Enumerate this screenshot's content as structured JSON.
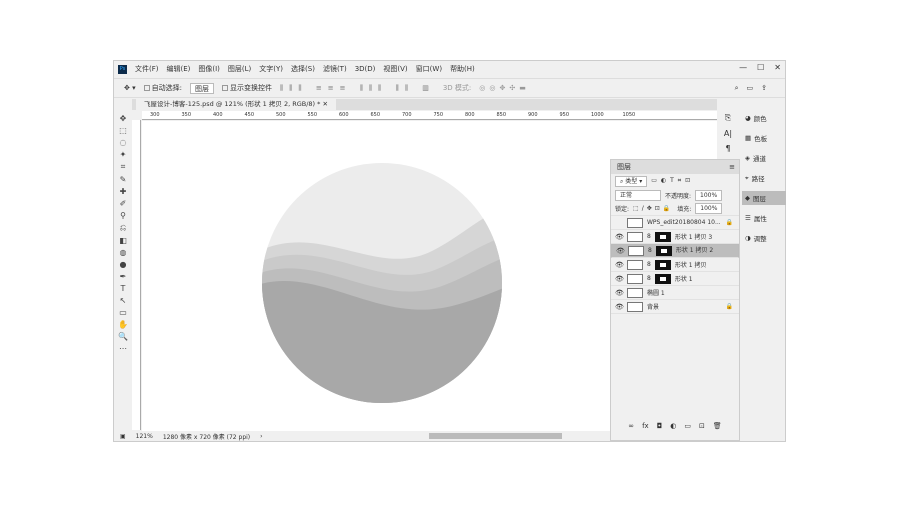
{
  "app": {
    "logo": "Ps"
  },
  "menu": [
    "文件(F)",
    "编辑(E)",
    "图像(I)",
    "图层(L)",
    "文字(Y)",
    "选择(S)",
    "滤镜(T)",
    "3D(D)",
    "视图(V)",
    "窗口(W)",
    "帮助(H)"
  ],
  "window_controls": [
    "—",
    "☐",
    "✕"
  ],
  "options": {
    "auto_select": "自动选择:",
    "target": "图层",
    "show_transform": "显示变换控件",
    "mode_3d": "3D 模式:"
  },
  "document_tab": "飞屋设计-博客-125.psd @ 121% (形状 1 拷贝 2, RGB/8) *",
  "ruler_labels": [
    "300",
    "350",
    "400",
    "450",
    "500",
    "550",
    "600",
    "650",
    "700",
    "750",
    "800",
    "850",
    "900",
    "950",
    "1000",
    "1050"
  ],
  "status": {
    "zoom": "121%",
    "doc_size": "1280 像素 x 720 像素 (72 ppi)"
  },
  "layers_panel": {
    "title": "图层",
    "filter": "类型",
    "blend_mode": "正常",
    "opacity_label": "不透明度:",
    "opacity": "100%",
    "lock_label": "锁定:",
    "fill_label": "填充:",
    "fill": "100%",
    "layers": [
      {
        "name": "WPS_edit20180804 10...",
        "visible": false,
        "mask": false,
        "locked": true,
        "selected": false
      },
      {
        "name": "形状 1 拷贝 3",
        "visible": true,
        "mask": true,
        "selected": false
      },
      {
        "name": "形状 1 拷贝 2",
        "visible": true,
        "mask": true,
        "selected": true
      },
      {
        "name": "形状 1 拷贝",
        "visible": true,
        "mask": true,
        "selected": false
      },
      {
        "name": "形状 1",
        "visible": true,
        "mask": true,
        "selected": false
      },
      {
        "name": "椭圆 1",
        "visible": true,
        "mask": false,
        "selected": false
      },
      {
        "name": "背景",
        "visible": true,
        "mask": false,
        "locked": true,
        "selected": false
      }
    ],
    "bottom_icons": [
      "∞",
      "fx",
      "◘",
      "◐",
      "▭",
      "⊡",
      "🗑"
    ]
  },
  "right_panels": [
    {
      "icon": "◕",
      "label": "颜色"
    },
    {
      "icon": "▦",
      "label": "色板"
    },
    {
      "icon": "◈",
      "label": "通道"
    },
    {
      "icon": "⌖",
      "label": "路径"
    },
    {
      "icon": "◆",
      "label": "图层",
      "active": true
    },
    {
      "icon": "☰",
      "label": "属性"
    },
    {
      "icon": "◑",
      "label": "调整"
    }
  ],
  "tools": [
    "✥",
    "⬚",
    "◌",
    "✦",
    "⌗",
    "✎",
    "✚",
    "✐",
    "⚲",
    "⎌",
    "◧",
    "◍",
    "●",
    "✒",
    "T",
    "↖",
    "▭",
    "✋",
    "🔍",
    "⋯"
  ]
}
